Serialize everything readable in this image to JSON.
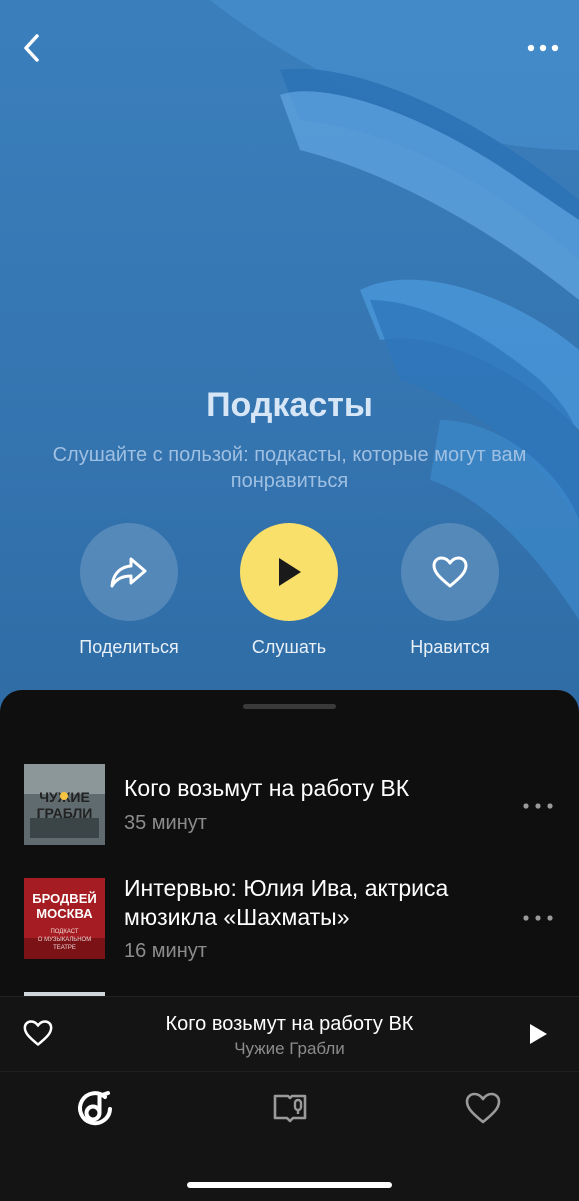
{
  "header": {
    "back_icon": "chevron-left-icon",
    "more_icon": "more-horizontal-icon"
  },
  "hero": {
    "title": "Подкасты",
    "subtitle": "Слушайте с пользой: подкасты, которые могут вам понравиться",
    "accent_color": "#f9e06a",
    "background_color": "#3677b3"
  },
  "actions": {
    "share_label": "Поделиться",
    "play_label": "Слушать",
    "like_label": "Нравится"
  },
  "episodes": [
    {
      "title": "Кого возьмут на работу ВК",
      "duration": "35 минут",
      "cover_title": "ЧУЖИЕ ГРАБЛИ"
    },
    {
      "title": "Интервью: Юлия Ива, актриса мюзикла «Шахматы»",
      "duration": "16 минут",
      "cover_title": "БРОДВЕЙ МОСКВА",
      "cover_subtitle": "ПОДКАСТ О МУЗЫКАЛЬНОМ ТЕАТРЕ"
    }
  ],
  "mini_player": {
    "title": "Кого возьмут на работу ВК",
    "subtitle": "Чужие Грабли"
  },
  "tabs": [
    {
      "icon": "music-note-icon",
      "active": true
    },
    {
      "icon": "podcast-book-icon",
      "active": false
    },
    {
      "icon": "heart-icon",
      "active": false
    }
  ]
}
